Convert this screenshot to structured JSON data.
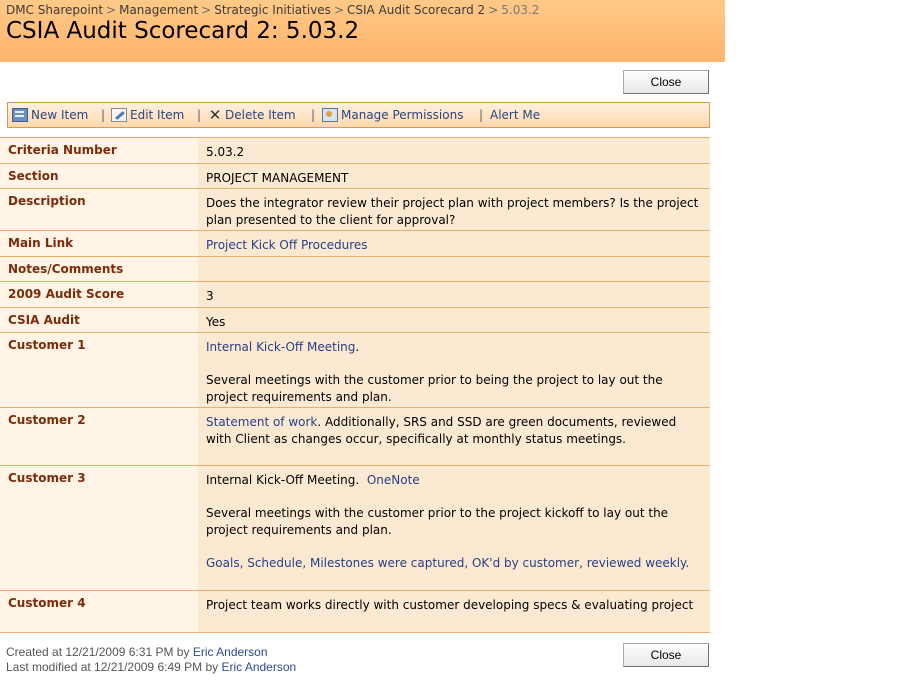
{
  "breadcrumb": {
    "items": [
      "DMC Sharepoint",
      "Management",
      "Strategic Initiatives",
      "CSIA Audit Scorecard 2"
    ],
    "current": "5.03.2",
    "separator": ">"
  },
  "page_title": "CSIA Audit Scorecard 2: 5.03.2",
  "close_label": "Close",
  "toolbar": {
    "new_item": "New Item",
    "edit_item": "Edit Item",
    "delete_item": "Delete Item",
    "manage_permissions": "Manage Permissions",
    "alert_me": "Alert Me",
    "separator": "|"
  },
  "fields": {
    "criteria_number": {
      "label": "Criteria Number",
      "value": "5.03.2"
    },
    "section": {
      "label": "Section",
      "value": "PROJECT MANAGEMENT"
    },
    "description": {
      "label": "Description",
      "value": "Does the integrator review their project plan with project members? Is the project plan presented to the client for approval?"
    },
    "main_link": {
      "label": "Main Link",
      "value": "Project Kick Off Procedures"
    },
    "notes": {
      "label": "Notes/Comments",
      "value": ""
    },
    "audit_score": {
      "label": "2009 Audit Score",
      "value": "3"
    },
    "csia_audit": {
      "label": "CSIA Audit",
      "value": "Yes"
    },
    "customer1": {
      "label": "Customer 1",
      "link": "Internal Kick-Off Meeting",
      "link_suffix": ".",
      "text": "Several meetings with the customer prior to being the project to lay out the project requirements and plan."
    },
    "customer2": {
      "label": "Customer 2",
      "link": "Statement of work",
      "text": ".  Additionally, SRS and SSD are green documents, reviewed with Client as changes occur, specifically at monthly status meetings."
    },
    "customer3": {
      "label": "Customer 3",
      "text_start": "Internal Kick-Off Meeting.  ",
      "link1": "OneNote",
      "text": "Several meetings with the customer prior to the project kickoff to lay out the project requirements and plan.",
      "link2": "Goals, Schedule, Milestones were captured, OK'd by customer, reviewed weekly."
    },
    "customer4": {
      "label": "Customer 4",
      "value": "Project team works directly with customer developing specs & evaluating project"
    }
  },
  "footer": {
    "created_prefix": "Created at 12/21/2009 6:31 PM  by",
    "created_by": "Eric Anderson",
    "modified_prefix": "Last modified at 12/21/2009 6:49 PM  by",
    "modified_by": "Eric Anderson"
  },
  "colors": {
    "header_bg": "#ffb46b",
    "label_text": "#7a2c0c",
    "link": "#263f85",
    "row_border": "#e8b06a"
  }
}
